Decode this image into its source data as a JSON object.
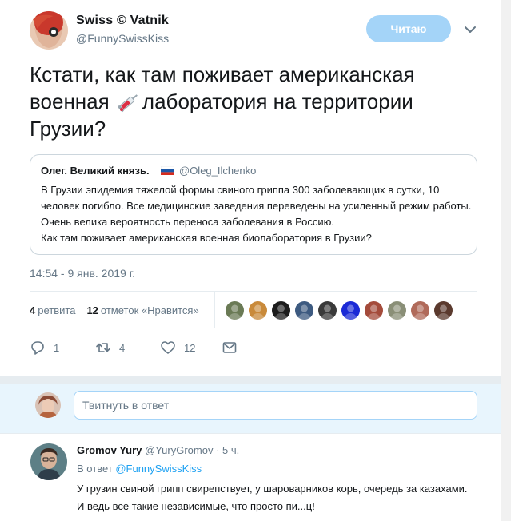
{
  "tweet": {
    "author_name": "Swiss © Vatnik",
    "author_handle": "@FunnySwissKiss",
    "follow_label": "Читаю",
    "text_part1": "Кстати, как там поживает американская военная ",
    "text_part2": "лаборатория на территории Грузии?",
    "emoji_icon": "syringe-icon",
    "timestamp": "14:54 - 9 янв. 2019 г."
  },
  "quote": {
    "name": "Олег. Великий князь.",
    "flag_icon": "russian-flag-icon",
    "handle": "@Oleg_Ilchenko",
    "body_line1": "В Грузии эпидемия тяжелой формы свиного гриппа 300 заболевающих в сутки, 10 человек погибло. Все медицинские заведения переведены на усиленный режим работы. Очень велика вероятность переноса заболевания в Россию.",
    "body_line2": "Как там поживает американская военная биолаборатория в Грузии?"
  },
  "stats": {
    "retweets_count": "4",
    "retweets_label": "ретвита",
    "likes_count": "12",
    "likes_label": "отметок «Нравится»",
    "liker_colors": [
      "#6a7a55",
      "#c98a3a",
      "#1c1c1c",
      "#3d5a80",
      "#3a3a3a",
      "#1b2ad6",
      "#a44b3b",
      "#8a8f77",
      "#b06a5a",
      "#5b3a2e"
    ]
  },
  "actions": {
    "reply_count": "1",
    "retweet_count": "4",
    "like_count": "12"
  },
  "composer": {
    "placeholder": "Твитнуть в ответ"
  },
  "reply": {
    "name": "Gromov Yury",
    "meta": "@YuryGromov · 5 ч.",
    "in_reply_prefix": "В ответ",
    "in_reply_handle": "@FunnySwissKiss",
    "text": "У грузин свиной грипп свирепствует, у шароварников корь, очередь за казахами. И ведь все такие независимые, что просто пи...ц!"
  },
  "colors": {
    "accent": "#1da1f2",
    "follow_button": "#a4d4f8",
    "muted_text": "#657786"
  }
}
